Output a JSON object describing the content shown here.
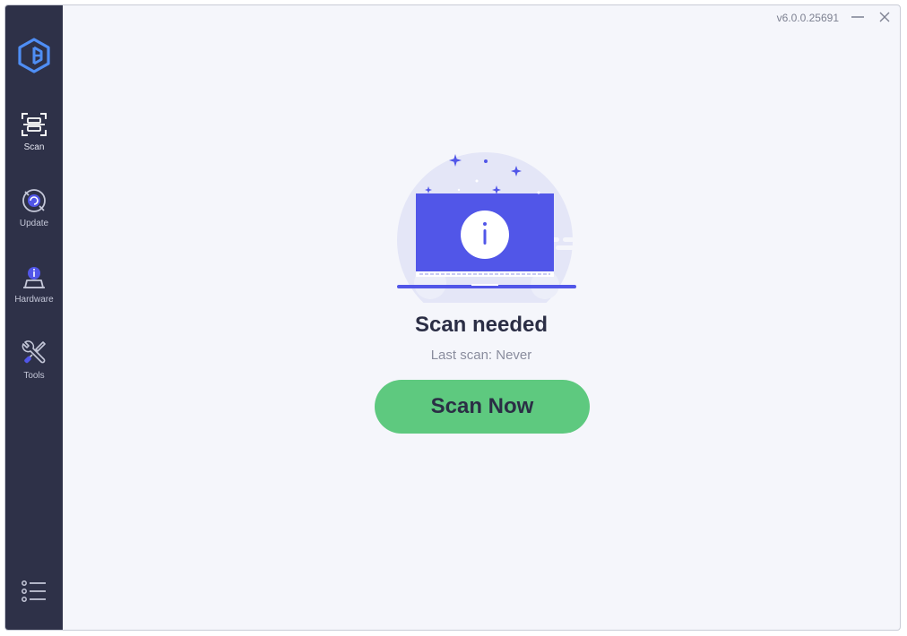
{
  "app": {
    "version": "v6.0.0.25691"
  },
  "sidebar": {
    "logo_icon": "shield-cube-logo",
    "items": [
      {
        "label": "Scan",
        "icon": "scan-frame-icon",
        "active": true
      },
      {
        "label": "Update",
        "icon": "update-refresh-icon",
        "active": false
      },
      {
        "label": "Hardware",
        "icon": "hardware-info-icon",
        "active": false
      },
      {
        "label": "Tools",
        "icon": "tools-wrench-icon",
        "active": false
      }
    ],
    "menu_icon": "list-menu-icon"
  },
  "window_controls": {
    "minimize_icon": "minimize-icon",
    "close_icon": "close-icon"
  },
  "main": {
    "illustration_icon": "laptop-info-icon",
    "title": "Scan needed",
    "subtitle": "Last scan: Never",
    "scan_button_label": "Scan Now"
  },
  "colors": {
    "sidebar_bg": "#2e3148",
    "content_bg": "#f5f6fb",
    "accent": "#5156e8",
    "scan_button": "#5ec97f",
    "title_text": "#2b2e45",
    "muted_text": "#8a8d9e"
  }
}
